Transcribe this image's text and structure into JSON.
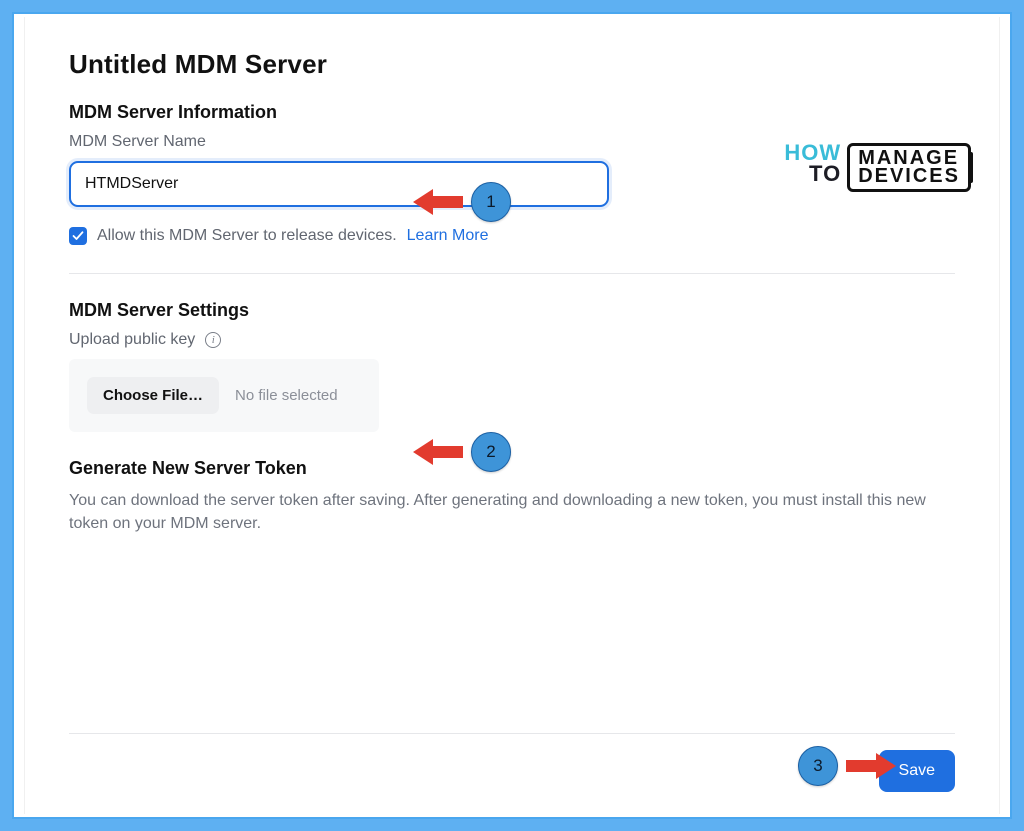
{
  "page": {
    "title": "Untitled MDM Server"
  },
  "info": {
    "heading": "MDM Server Information",
    "name_label": "MDM Server Name",
    "name_value": "HTMDServer",
    "allow_release_label": "Allow this MDM Server to release devices.",
    "learn_more": "Learn More"
  },
  "settings": {
    "heading": "MDM Server Settings",
    "upload_label": "Upload public key",
    "choose_file": "Choose File…",
    "file_status": "No file selected"
  },
  "token": {
    "heading": "Generate New Server Token",
    "text": "You can download the server token after saving. After generating and downloading a new token, you must install this new token on your MDM server."
  },
  "actions": {
    "save": "Save"
  },
  "annotations": {
    "step1": "1",
    "step2": "2",
    "step3": "3"
  },
  "logo": {
    "how": "HOW",
    "to": "TO",
    "line1": "MANAGE",
    "line2": "DEVICES"
  }
}
